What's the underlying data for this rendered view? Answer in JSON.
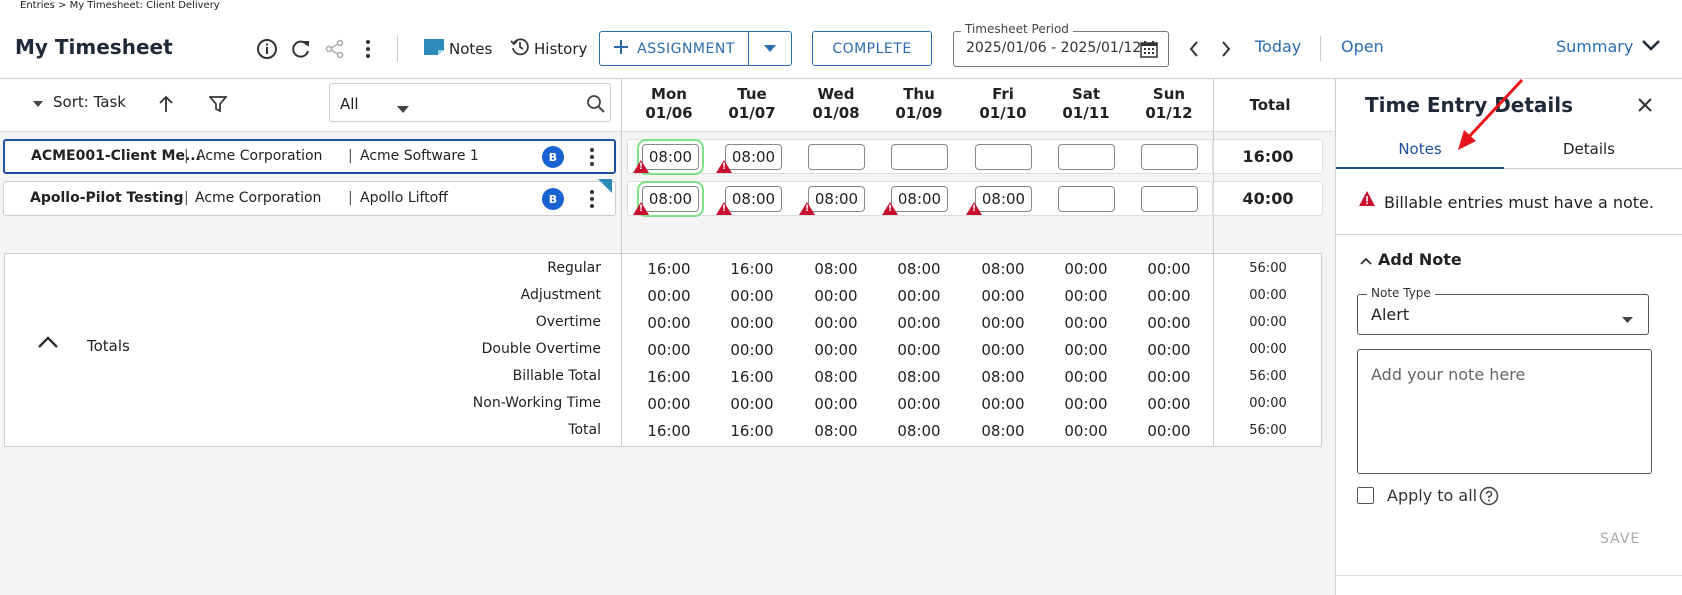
{
  "breadcrumb": "Entries > My Timesheet: Client Delivery",
  "page_title": "My Timesheet",
  "toolbar": {
    "notes_label": "Notes",
    "history_label": "History",
    "assignment_label": "ASSIGNMENT",
    "complete_label": "COMPLETE",
    "period_label": "Timesheet Period",
    "period_value": "2025/01/06 - 2025/01/12",
    "today_label": "Today",
    "open_label": "Open",
    "summary_label": "Summary"
  },
  "grid": {
    "sort_label": "Sort: Task",
    "filter_value": "All",
    "days": [
      {
        "day": "Mon",
        "date": "01/06"
      },
      {
        "day": "Tue",
        "date": "01/07"
      },
      {
        "day": "Wed",
        "date": "01/08"
      },
      {
        "day": "Thu",
        "date": "01/09"
      },
      {
        "day": "Fri",
        "date": "01/10"
      },
      {
        "day": "Sat",
        "date": "01/11"
      },
      {
        "day": "Sun",
        "date": "01/12"
      }
    ],
    "total_header": "Total",
    "rows": [
      {
        "task": "ACME001-Client Me...",
        "client": "Acme Corporation",
        "project": "Acme Software 1",
        "badge": "B",
        "hours": [
          "08:00",
          "08:00",
          "",
          "",
          "",
          "",
          ""
        ],
        "total": "16:00"
      },
      {
        "task": "Apollo-Pilot Testing",
        "client": "Acme Corporation",
        "project": "Apollo Liftoff",
        "badge": "B",
        "hours": [
          "08:00",
          "08:00",
          "08:00",
          "08:00",
          "08:00",
          "",
          ""
        ],
        "total": "40:00"
      }
    ]
  },
  "totals": {
    "section_label": "Totals",
    "rows": [
      {
        "label": "Regular",
        "values": [
          "16:00",
          "16:00",
          "08:00",
          "08:00",
          "08:00",
          "00:00",
          "00:00"
        ],
        "total": "56:00"
      },
      {
        "label": "Adjustment",
        "values": [
          "00:00",
          "00:00",
          "00:00",
          "00:00",
          "00:00",
          "00:00",
          "00:00"
        ],
        "total": "00:00"
      },
      {
        "label": "Overtime",
        "values": [
          "00:00",
          "00:00",
          "00:00",
          "00:00",
          "00:00",
          "00:00",
          "00:00"
        ],
        "total": "00:00"
      },
      {
        "label": "Double Overtime",
        "values": [
          "00:00",
          "00:00",
          "00:00",
          "00:00",
          "00:00",
          "00:00",
          "00:00"
        ],
        "total": "00:00"
      },
      {
        "label": "Billable Total",
        "values": [
          "16:00",
          "16:00",
          "08:00",
          "08:00",
          "08:00",
          "00:00",
          "00:00"
        ],
        "total": "56:00"
      },
      {
        "label": "Non-Working Time",
        "values": [
          "00:00",
          "00:00",
          "00:00",
          "00:00",
          "00:00",
          "00:00",
          "00:00"
        ],
        "total": "00:00"
      },
      {
        "label": "Total",
        "values": [
          "16:00",
          "16:00",
          "08:00",
          "08:00",
          "08:00",
          "00:00",
          "00:00"
        ],
        "total": "56:00"
      }
    ]
  },
  "panel": {
    "title": "Time Entry Details",
    "tabs": [
      "Notes",
      "Details"
    ],
    "alert": "Billable entries must have a note.",
    "add_note_label": "Add Note",
    "note_type_label": "Note Type",
    "note_type_value": "Alert",
    "note_placeholder": "Add your note here",
    "apply_all_label": "Apply to all",
    "save_label": "SAVE"
  },
  "colors": {
    "accent": "#1e4f9c",
    "link": "#2b6cb0",
    "badge": "#1a62d1",
    "warning": "#c8102e",
    "active_cell": "#7ee08a",
    "annotation_arrow": "#e8141c"
  }
}
